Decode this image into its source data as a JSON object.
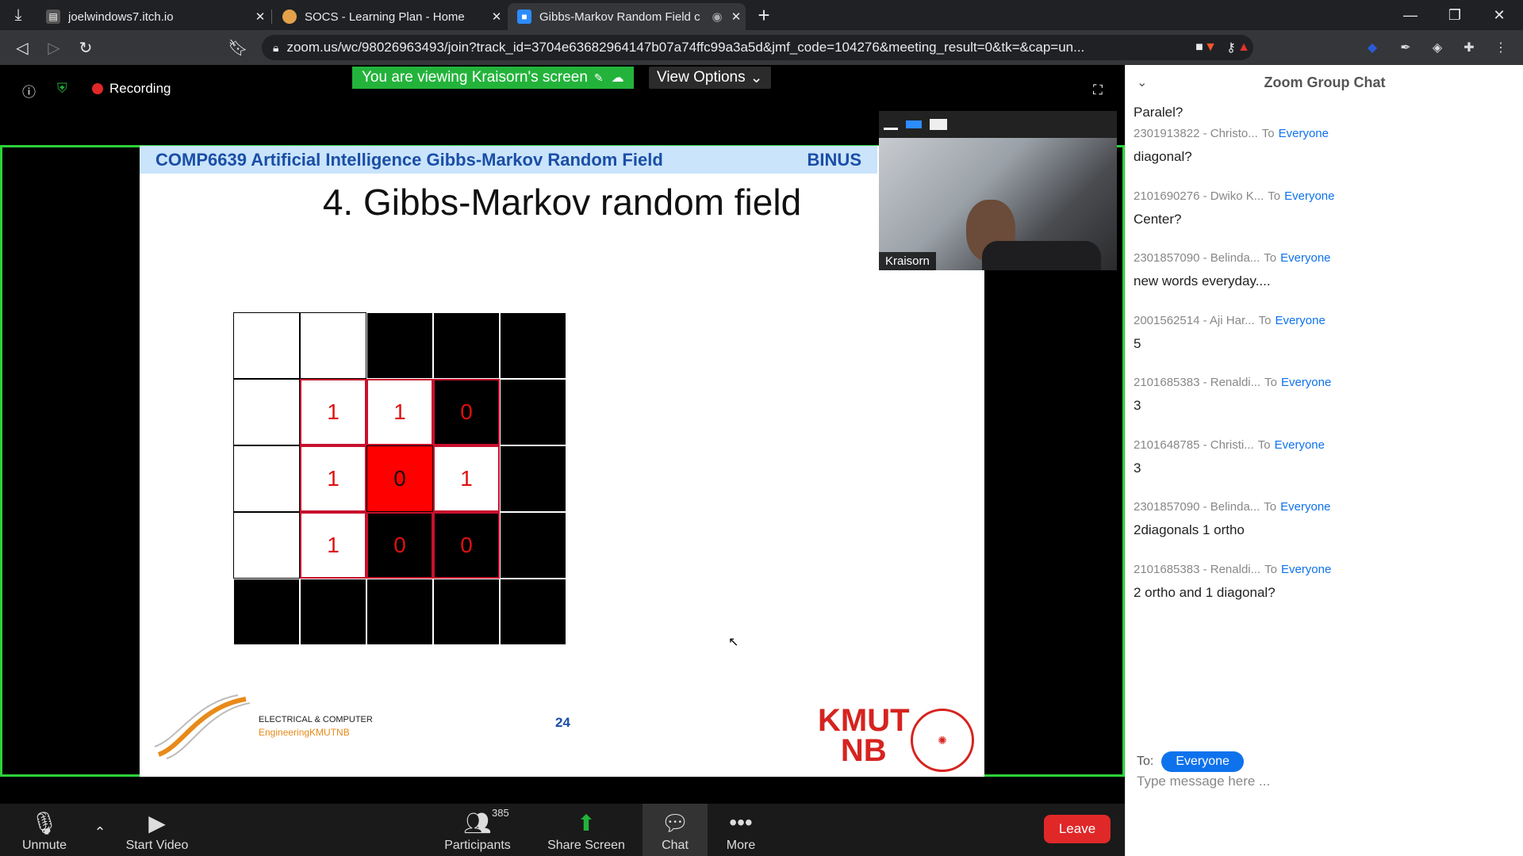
{
  "browser": {
    "tabs": [
      {
        "label": "joelwindows7.itch.io"
      },
      {
        "label": "SOCS - Learning Plan - Home"
      },
      {
        "label": "Gibbs-Markov Random Field c"
      }
    ],
    "url": "zoom.us/wc/98026963493/join?track_id=3704e63682964147b07a74ffc99a3a5d&jmf_code=104276&meeting_result=0&tk=&cap=un..."
  },
  "meeting": {
    "recording_label": "Recording",
    "viewing_banner": "You are viewing Kraisorn's screen",
    "view_options": "View Options",
    "video_name": "Kraisorn"
  },
  "slide": {
    "header_left": "COMP6639 Artificial Intelligence Gibbs-Markov Random Field",
    "header_right": "BINUS",
    "title": "4. Gibbs-Markov random field",
    "grid": [
      [
        {
          "t": "",
          "c": "w"
        },
        {
          "t": "",
          "c": "w"
        },
        {
          "t": "",
          "c": "b"
        },
        {
          "t": "",
          "c": "b"
        },
        {
          "t": "",
          "c": "b"
        }
      ],
      [
        {
          "t": "",
          "c": "w"
        },
        {
          "t": "1",
          "c": "w rb"
        },
        {
          "t": "1",
          "c": "w rb"
        },
        {
          "t": "0",
          "c": "b rb"
        },
        {
          "t": "",
          "c": "b"
        }
      ],
      [
        {
          "t": "",
          "c": "w"
        },
        {
          "t": "1",
          "c": "w rb"
        },
        {
          "t": "0",
          "c": "r"
        },
        {
          "t": "1",
          "c": "w rb"
        },
        {
          "t": "",
          "c": "b"
        }
      ],
      [
        {
          "t": "",
          "c": "w"
        },
        {
          "t": "1",
          "c": "w rb"
        },
        {
          "t": "0",
          "c": "b rb"
        },
        {
          "t": "0",
          "c": "b rb"
        },
        {
          "t": "",
          "c": "b"
        }
      ],
      [
        {
          "t": "",
          "c": "b"
        },
        {
          "t": "",
          "c": "b"
        },
        {
          "t": "",
          "c": "b"
        },
        {
          "t": "",
          "c": "b"
        },
        {
          "t": "",
          "c": "b"
        }
      ]
    ],
    "page_number": "24",
    "logo_left_line1": "ELECTRICAL & COMPUTER",
    "logo_left_line2": "EngineeringKMUTNB",
    "logo_right_line1": "KMUT",
    "logo_right_line2": "NB"
  },
  "chat": {
    "title": "Zoom Group Chat",
    "first_message": "Paralel?",
    "messages": [
      {
        "sender": "2301913822 - Christo...",
        "text": "diagonal?"
      },
      {
        "sender": "2101690276 - Dwiko K...",
        "text": "Center?"
      },
      {
        "sender": "2301857090 - Belinda...",
        "text": "new words everyday...."
      },
      {
        "sender": "2001562514 - Aji Har...",
        "text": "5"
      },
      {
        "sender": "2101685383 - Renaldi...",
        "text": "3"
      },
      {
        "sender": "2101648785 - Christi...",
        "text": "3"
      },
      {
        "sender": "2301857090 - Belinda...",
        "text": "2diagonals 1 ortho"
      },
      {
        "sender": "2101685383 - Renaldi...",
        "text": "2 ortho and 1 diagonal?"
      }
    ],
    "to_word": "To",
    "everyone": "Everyone",
    "to_label": "To:",
    "recipient": "Everyone",
    "placeholder": "Type message here ..."
  },
  "toolbar": {
    "unmute": "Unmute",
    "start_video": "Start Video",
    "participants": "Participants",
    "participant_count": "385",
    "share_screen": "Share Screen",
    "chat": "Chat",
    "more": "More",
    "leave": "Leave"
  },
  "colors": {
    "accent": "#0e72ed",
    "share_border": "#2dd23a",
    "leave": "#e02828",
    "slide_red": "#ff0000"
  }
}
